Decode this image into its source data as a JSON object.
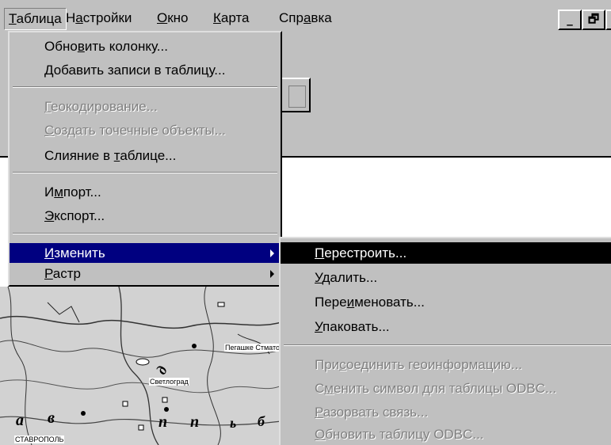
{
  "menubar": {
    "items": [
      {
        "pre": "",
        "u": "Т",
        "post": "аблица"
      },
      {
        "pre": "Н",
        "u": "а",
        "post": "стройки"
      },
      {
        "pre": "",
        "u": "О",
        "post": "кно"
      },
      {
        "pre": "",
        "u": "К",
        "post": "арта"
      },
      {
        "pre": "Спр",
        "u": "а",
        "post": "вка"
      }
    ],
    "window_buttons": [
      "_",
      "🗗",
      "×"
    ]
  },
  "table_menu": {
    "items": [
      {
        "pre": "Обно",
        "u": "в",
        "post": "ить колонку..."
      },
      {
        "pre": "",
        "u": "Д",
        "post": "обавить записи в таблицу..."
      },
      {
        "pre": "",
        "u": "Г",
        "post": "еокодирование..."
      },
      {
        "pre": "",
        "u": "С",
        "post": "оздать точечные объекты..."
      },
      {
        "pre": "Слияние в ",
        "u": "т",
        "post": "аблице..."
      },
      {
        "pre": "И",
        "u": "м",
        "post": "порт..."
      },
      {
        "pre": "",
        "u": "Э",
        "post": "кспорт..."
      },
      {
        "pre": "",
        "u": "И",
        "post": "зменить"
      },
      {
        "pre": "",
        "u": "Р",
        "post": "астр"
      }
    ]
  },
  "change_submenu": {
    "items": [
      {
        "pre": "",
        "u": "П",
        "post": "ерестроить..."
      },
      {
        "pre": "",
        "u": "У",
        "post": "далить..."
      },
      {
        "pre": "Пере",
        "u": "и",
        "post": "меновать..."
      },
      {
        "pre": "",
        "u": "У",
        "post": "паковать..."
      },
      {
        "pre": "При",
        "u": "с",
        "post": "оединить геоинформацию..."
      },
      {
        "pre": "С",
        "u": "м",
        "post": "енить символ для таблицы ODBC..."
      },
      {
        "pre": "",
        "u": "Р",
        "post": "азорвать связь..."
      },
      {
        "pre": "",
        "u": "О",
        "post": "бновить таблицу ODBC..."
      }
    ]
  },
  "map": {
    "labels": [
      "а",
      "в",
      "д",
      "п",
      "б",
      "ь",
      "п"
    ],
    "places": [
      "СТАВРОПОЛЬ",
      "Светлоград",
      "Пегашке Стмато"
    ]
  },
  "colors": {
    "menu_bg": "#c0c0c0",
    "highlight": "#000080",
    "disabled": "#808080"
  }
}
